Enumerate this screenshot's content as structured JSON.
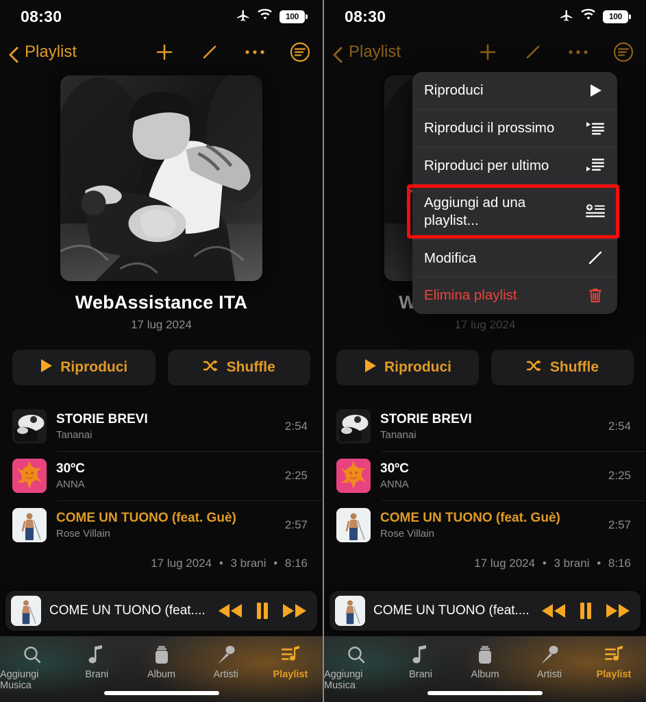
{
  "colors": {
    "accent": "#e09b26",
    "accent_bright": "#f5a623",
    "destructive": "#ef4237",
    "highlight_box": "#f40d0d",
    "background": "#0a0a0a",
    "surface": "#1c1c1e",
    "menu_surface": "#2c2c2e",
    "secondary_text": "#8e8e93"
  },
  "status_bar": {
    "time": "08:30",
    "icons": [
      "airplane-mode-icon",
      "wifi-icon",
      "battery-icon"
    ],
    "battery_level": "100"
  },
  "navbar": {
    "back_label": "Playlist",
    "back_icon": "chevron-left-icon",
    "actions": [
      "add-icon",
      "edit-pencil-icon",
      "more-options-icon",
      "sort-list-icon"
    ]
  },
  "hero": {
    "cover_alt": "playlist-cover-artwork",
    "title": "WebAssistance ITA",
    "subtitle": "17 lug 2024"
  },
  "buttons": {
    "play": {
      "label": "Riproduci",
      "icon": "play-triangle-icon"
    },
    "shuffle": {
      "label": "Shuffle",
      "icon": "shuffle-icon"
    }
  },
  "songs": [
    {
      "title": "STORIE BREVI",
      "artist": "Tananai",
      "duration": "2:54",
      "playing": false,
      "art": "storie-brevi-art"
    },
    {
      "title": "30ºC",
      "artist": "ANNA",
      "duration": "2:25",
      "playing": false,
      "art": "trenta-gradi-art"
    },
    {
      "title": "COME UN TUONO (feat. Guè)",
      "artist": "Rose Villain",
      "duration": "2:57",
      "playing": true,
      "art": "come-un-tuono-art"
    }
  ],
  "list_footer": {
    "date": "17 lug 2024",
    "count": "3 brani",
    "total_time": "8:16",
    "separator": "•"
  },
  "miniplayer": {
    "title": "COME UN TUONO (feat....",
    "art": "come-un-tuono-art",
    "controls": [
      "rewind-icon",
      "pause-icon",
      "fast-forward-icon"
    ]
  },
  "tabbar": {
    "items": [
      {
        "label": "Aggiungi Musica",
        "icon": "search-icon",
        "active": false
      },
      {
        "label": "Brani",
        "icon": "music-note-icon",
        "active": false
      },
      {
        "label": "Album",
        "icon": "album-icon",
        "active": false
      },
      {
        "label": "Artisti",
        "icon": "microphone-icon",
        "active": false
      },
      {
        "label": "Playlist",
        "icon": "playlist-icon",
        "active": true
      }
    ]
  },
  "context_menu": {
    "items": [
      {
        "label": "Riproduci",
        "icon": "play-triangle-icon",
        "destructive": false,
        "highlighted": false
      },
      {
        "label": "Riproduci il prossimo",
        "icon": "play-next-icon",
        "destructive": false,
        "highlighted": false
      },
      {
        "label": "Riproduci per ultimo",
        "icon": "play-last-icon",
        "destructive": false,
        "highlighted": false
      },
      {
        "label": "Aggiungi ad una playlist...",
        "icon": "add-to-playlist-icon",
        "destructive": false,
        "highlighted": true
      },
      {
        "label": "Modifica",
        "icon": "edit-pencil-icon",
        "destructive": false,
        "highlighted": false
      },
      {
        "label": "Elimina playlist",
        "icon": "trash-icon",
        "destructive": true,
        "highlighted": false
      }
    ]
  }
}
